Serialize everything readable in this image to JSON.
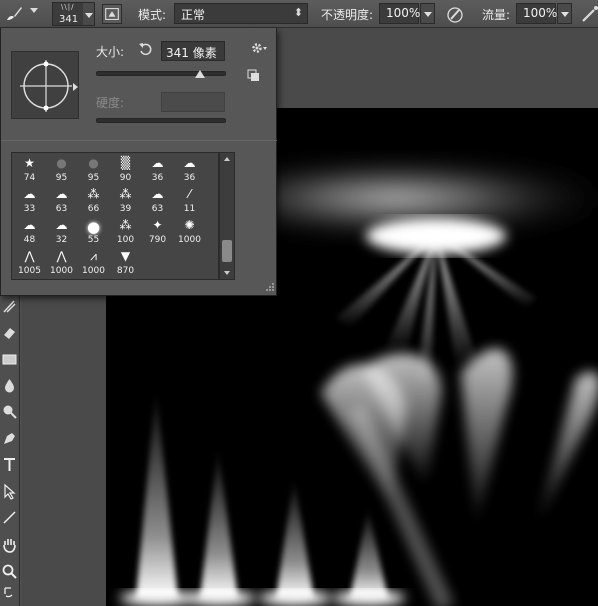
{
  "options_bar": {
    "brush_size": "341",
    "mode_label": "模式:",
    "mode_value": "正常",
    "opacity_label": "不透明度:",
    "opacity_value": "100%",
    "flow_label": "流量:",
    "flow_value": "100%"
  },
  "brush_picker": {
    "size_label": "大小:",
    "size_value": "341 像素",
    "size_slider_fraction": 0.8,
    "hardness_label": "硬度:",
    "presets": [
      {
        "icon": "star-brush",
        "size": "74"
      },
      {
        "icon": "drop-brush",
        "size": "95"
      },
      {
        "icon": "drop-brush",
        "size": "95"
      },
      {
        "icon": "texture-brush",
        "size": "90"
      },
      {
        "icon": "cloud-brush",
        "size": "36"
      },
      {
        "icon": "cloud-brush",
        "size": "36"
      },
      {
        "icon": "cloud-brush",
        "size": "33"
      },
      {
        "icon": "cloud-brush",
        "size": "63"
      },
      {
        "icon": "spray-brush",
        "size": "66"
      },
      {
        "icon": "spray-brush",
        "size": "39"
      },
      {
        "icon": "cloud-brush",
        "size": "63"
      },
      {
        "icon": "streak-brush",
        "size": "11"
      },
      {
        "icon": "cloud-brush",
        "size": "48"
      },
      {
        "icon": "cloud-brush",
        "size": "32"
      },
      {
        "icon": "soft-round-brush",
        "size": "55"
      },
      {
        "icon": "spray-brush",
        "size": "100"
      },
      {
        "icon": "light-beam-brush",
        "size": "790"
      },
      {
        "icon": "light-burst-brush",
        "size": "1000"
      },
      {
        "icon": "light-rays-brush",
        "size": "1005"
      },
      {
        "icon": "light-rays-brush",
        "size": "1000"
      },
      {
        "icon": "light-spikes-brush",
        "size": "1000"
      },
      {
        "icon": "spotlight-brush",
        "size": "870"
      }
    ]
  },
  "toolbar": {
    "tools": [
      "path-select-icon",
      "eraser-icon",
      "gradient-icon",
      "blur-icon",
      "dodge-icon",
      "pen-icon",
      "type-icon",
      "direct-select-icon",
      "line-icon",
      "hand-icon",
      "zoom-icon"
    ]
  }
}
